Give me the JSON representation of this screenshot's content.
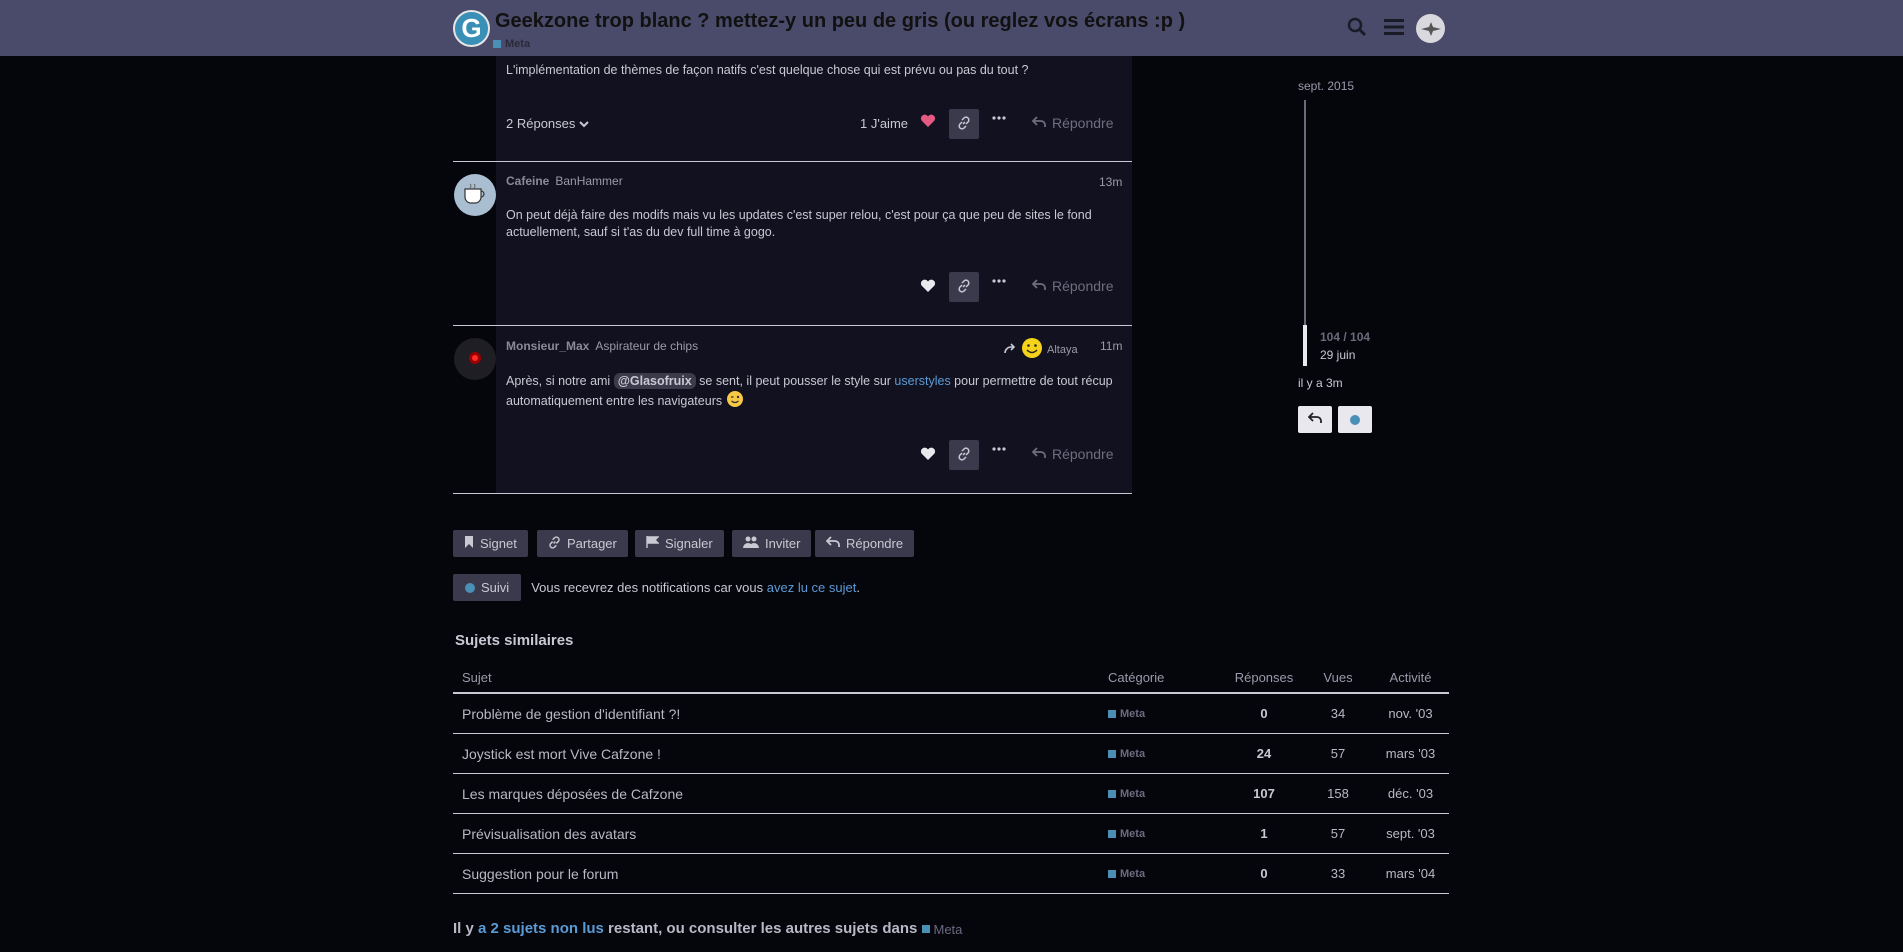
{
  "header": {
    "logo_letter": "G",
    "title": "Geekzone trop blanc ? mettez-y un peu de gris (ou reglez vos écrans :p )",
    "category": "Meta",
    "icons": [
      "search-icon",
      "hamburger-menu-icon",
      "user-avatar"
    ]
  },
  "posts": [
    {
      "text": "L'implémentation de thèmes de façon natifs c'est quelque chose qui est prévu ou pas du tout ?",
      "replies_label": "2 Réponses",
      "likes_label": "1 J'aime",
      "reply_label": "Répondre"
    },
    {
      "username": "Cafeine",
      "user_title": "BanHammer",
      "date": "13m",
      "text": "On peut déjà faire des modifs mais vu les updates c'est super relou, c'est pour ça que peu de sites le fond actuellement, sauf si t'as du dev full time à gogo.",
      "reply_label": "Répondre"
    },
    {
      "username": "Monsieur_Max",
      "user_title": "Aspirateur de chips",
      "reply_to": "Altaya",
      "date": "11m",
      "text_before": "Après, si notre ami ",
      "mention": "@Glasofruix",
      "text_middle": " se sent, il peut pousser le style sur ",
      "link": "userstyles",
      "text_after": " pour permettre de tout récup automatiquement entre les navigateurs ",
      "reply_label": "Répondre"
    }
  ],
  "timeline": {
    "start_date": "sept. 2015",
    "position": "104 / 104",
    "position_date": "29 juin",
    "last_activity": "il y a 3m"
  },
  "footer_buttons": {
    "bookmark": "Signet",
    "share": "Partager",
    "flag": "Signaler",
    "invite": "Inviter",
    "reply": "Répondre"
  },
  "notifications": {
    "button": "Suivi",
    "text_before": "Vous recevrez des notifications car vous ",
    "link": "avez lu ce sujet",
    "text_after": "."
  },
  "similar": {
    "title": "Sujets similaires",
    "columns": [
      "Sujet",
      "Catégorie",
      "Réponses",
      "Vues",
      "Activité"
    ],
    "rows": [
      {
        "title": "Problème de gestion d'identifiant ?!",
        "category": "Meta",
        "replies": "0",
        "views": "34",
        "activity": "nov. '03"
      },
      {
        "title": "Joystick est mort Vive Cafzone !",
        "category": "Meta",
        "replies": "24",
        "views": "57",
        "activity": "mars '03"
      },
      {
        "title": "Les marques déposées de Cafzone",
        "category": "Meta",
        "replies": "107",
        "views": "158",
        "activity": "déc. '03"
      },
      {
        "title": "Prévisualisation des avatars",
        "category": "Meta",
        "replies": "1",
        "views": "57",
        "activity": "sept. '03"
      },
      {
        "title": "Suggestion pour le forum",
        "category": "Meta",
        "replies": "0",
        "views": "33",
        "activity": "mars '04"
      }
    ]
  },
  "suggested": {
    "text_before": "Il y ",
    "link": "a 2 sujets non lus",
    "text_middle": " restant, ou consulter les autres sujets dans ",
    "category": "Meta"
  },
  "colors": {
    "header_bg": "#4a4a6a",
    "page_bg": "#05050c",
    "post_bg": "#11111f",
    "accent": "#5b9bd5",
    "category": "#4a8fb5",
    "like": "#e45a82"
  }
}
